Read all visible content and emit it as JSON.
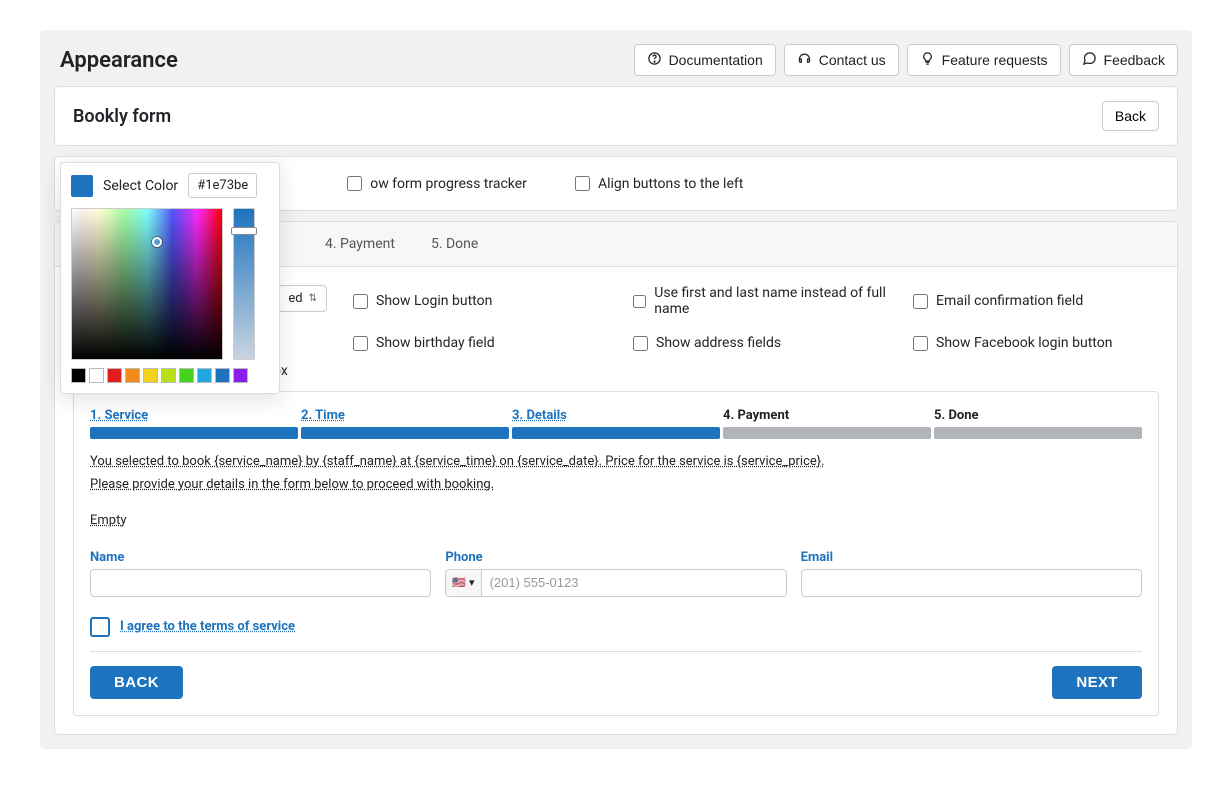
{
  "header": {
    "title": "Appearance",
    "buttons": {
      "documentation": "Documentation",
      "contact": "Contact us",
      "features": "Feature requests",
      "feedback": "Feedback"
    }
  },
  "card": {
    "title": "Bookly form",
    "back": "Back"
  },
  "color": {
    "label": "Select Color",
    "hex": "#1e73be",
    "palette": [
      "#000000",
      "#ffffff",
      "#e11d1d",
      "#f08a18",
      "#f3d21e",
      "#b7e018",
      "#47d21f",
      "#1ea7e0",
      "#1e73be",
      "#8b1eea"
    ]
  },
  "options": {
    "show_progress": "Show form progress tracker",
    "align_left": "Align buttons to the left",
    "truncated_show_progress_tail": "ow form progress tracker"
  },
  "tabs": {
    "t4": "4. Payment",
    "t5": "5. Done"
  },
  "settings": {
    "select_trunc_tail": "ed",
    "show_login": "Show Login button",
    "use_first_last": "Use first and last name instead of full name",
    "email_conf": "Email confirmation field",
    "show_birthday": "Show birthday field",
    "show_address": "Show address fields",
    "show_facebook": "Show Facebook login button",
    "lower_trunc_tail": "ox"
  },
  "preview": {
    "steps": [
      "1. Service",
      "2. Time",
      "3. Details",
      "4. Payment",
      "5. Done"
    ],
    "summary1": "You selected to book {service_name} by {staff_name} at {service_time} on {service_date}. Price for the service is {service_price}.",
    "summary2": "Please provide your details in the form below to proceed with booking.",
    "empty": "Empty",
    "name_label": "Name",
    "phone_label": "Phone",
    "phone_placeholder": "(201) 555-0123",
    "email_label": "Email",
    "terms": "I agree to the terms of service",
    "back": "BACK",
    "next": "NEXT",
    "flag": "🇺🇸"
  }
}
